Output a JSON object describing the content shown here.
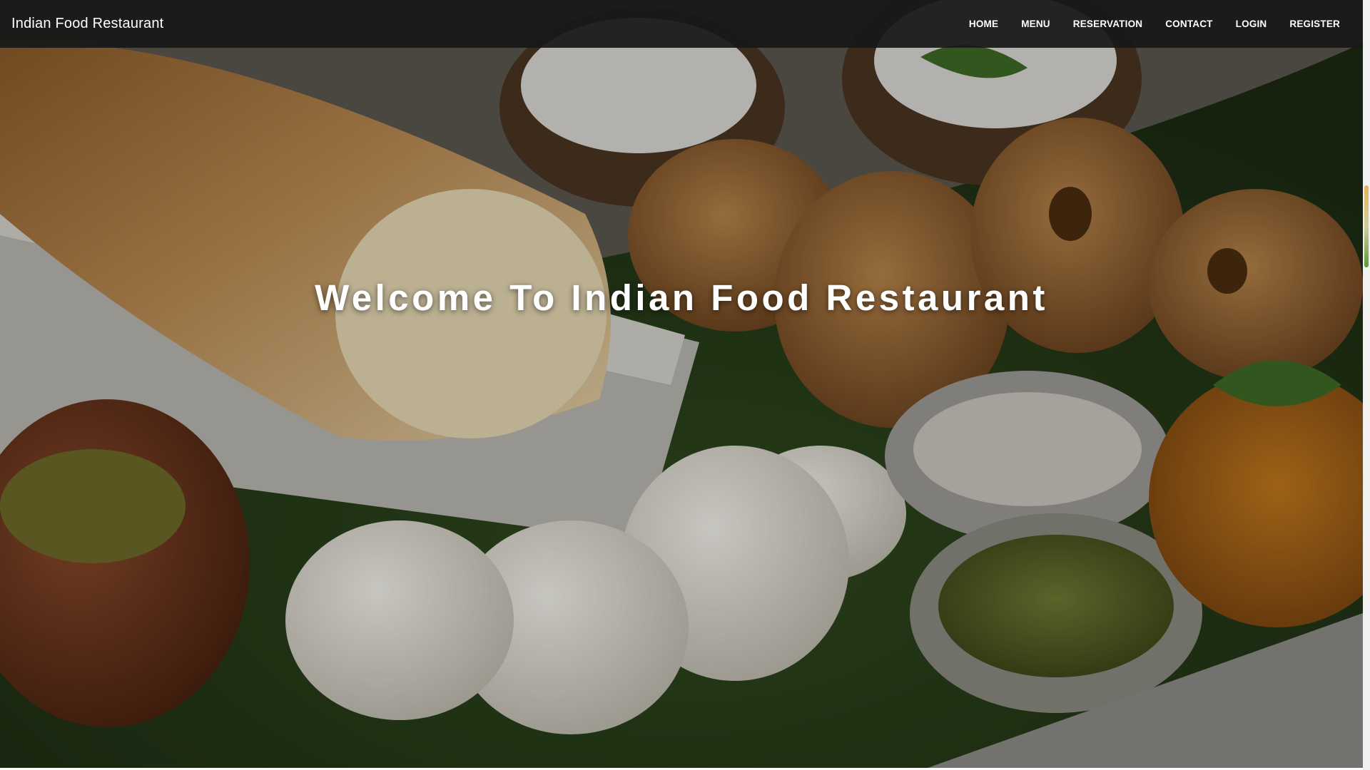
{
  "navbar": {
    "brand": "Indian Food Restaurant",
    "links": [
      {
        "label": "HOME"
      },
      {
        "label": "MENU"
      },
      {
        "label": "RESERVATION"
      },
      {
        "label": "CONTACT"
      },
      {
        "label": "LOGIN"
      },
      {
        "label": "REGISTER"
      }
    ]
  },
  "hero": {
    "title": "Welcome To Indian Food Restaurant"
  },
  "colors": {
    "navbar_bg": "#181818",
    "nav_text": "#ffffff",
    "hero_text": "#ffffff"
  }
}
